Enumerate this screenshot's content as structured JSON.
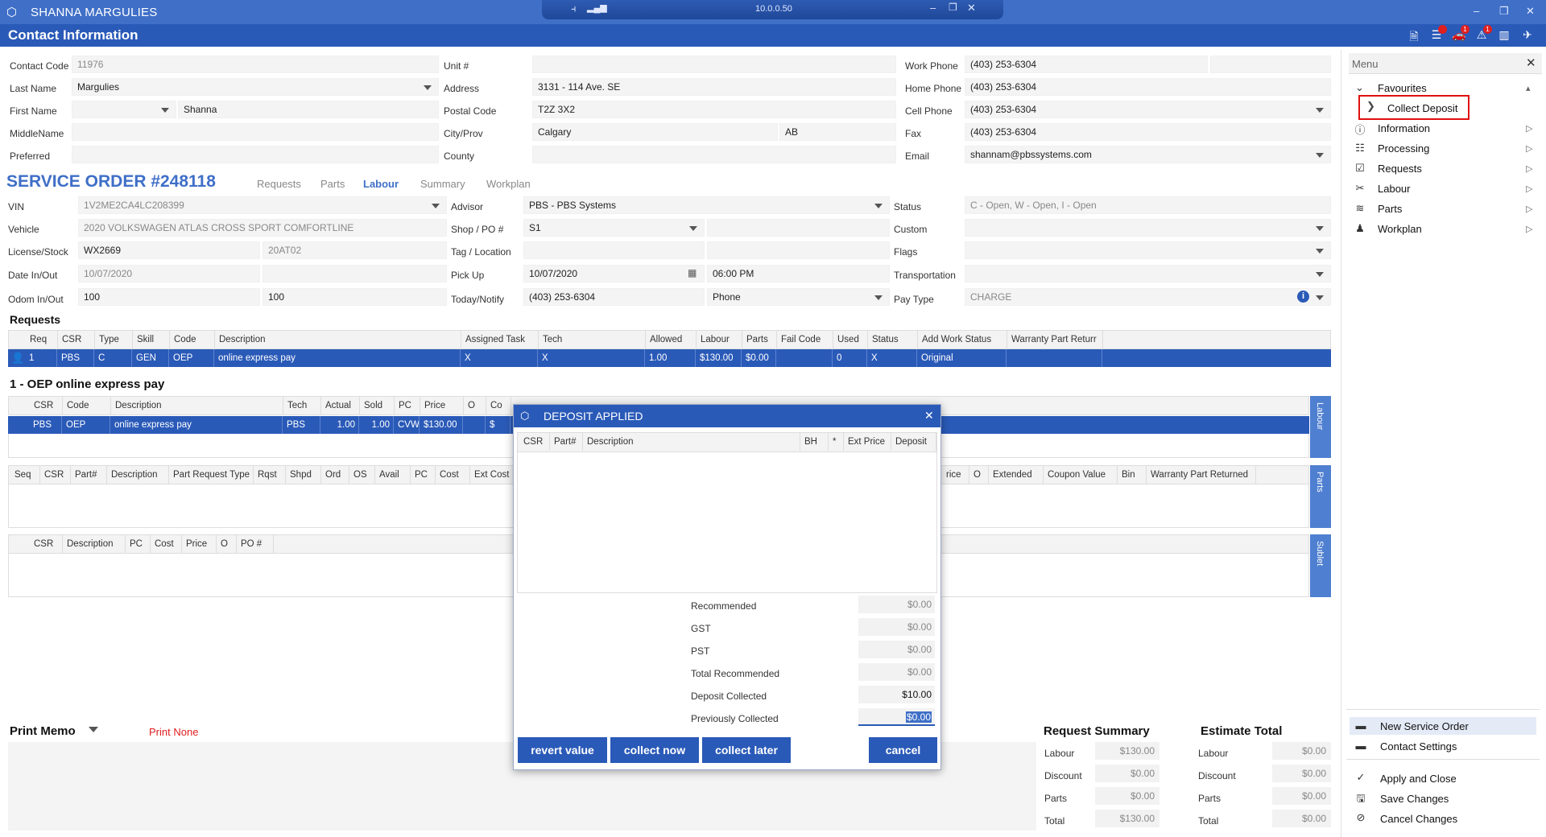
{
  "window": {
    "title": "SHANNA MARGULIES",
    "ip": "10.0.0.50"
  },
  "header": {
    "title": "Contact Information"
  },
  "contact": {
    "contact_code_label": "Contact Code",
    "contact_code": "11976",
    "last_name_label": "Last Name",
    "last_name": "Margulies",
    "first_name_label": "First Name",
    "first_name": "Shanna",
    "middle_name_label": "MiddleName",
    "preferred_label": "Preferred",
    "unit_label": "Unit #",
    "address_label": "Address",
    "address": "3131 - 114 Ave. SE",
    "postal_label": "Postal Code",
    "postal": "T2Z 3X2",
    "city_label": "City/Prov",
    "city": "Calgary",
    "prov": "AB",
    "county_label": "County",
    "work_phone_label": "Work Phone",
    "work_phone": "(403) 253-6304",
    "home_phone_label": "Home Phone",
    "home_phone": "(403) 253-6304",
    "cell_phone_label": "Cell Phone",
    "cell_phone": "(403) 253-6304",
    "fax_label": "Fax",
    "fax": "(403) 253-6304",
    "email_label": "Email",
    "email": "shannam@pbssystems.com"
  },
  "service_order": {
    "title": "SERVICE ORDER #248118",
    "tabs": [
      "Requests",
      "Parts",
      "Labour",
      "Summary",
      "Workplan"
    ],
    "vin_label": "VIN",
    "vin": "1V2ME2CA4LC208399",
    "vehicle_label": "Vehicle",
    "vehicle": "2020 VOLKSWAGEN ATLAS CROSS SPORT COMFORTLINE",
    "license_label": "License/Stock",
    "license": "WX2669",
    "stock": "20AT02",
    "date_label": "Date In/Out",
    "date_in": "10/07/2020",
    "odom_label": "Odom In/Out",
    "odom_in": "100",
    "odom_out": "100",
    "advisor_label": "Advisor",
    "advisor": "PBS - PBS Systems",
    "shop_label": "Shop / PO #",
    "shop": "S1",
    "tag_label": "Tag / Location",
    "pickup_label": "Pick Up",
    "pickup_date": "10/07/2020",
    "pickup_time": "06:00 PM",
    "notify_label": "Today/Notify",
    "notify": "(403) 253-6304",
    "notify_type": "Phone",
    "status_label": "Status",
    "status": "C - Open, W - Open, I - Open",
    "custom_label": "Custom",
    "flags_label": "Flags",
    "transport_label": "Transportation",
    "paytype_label": "Pay Type",
    "paytype": "CHARGE"
  },
  "requests": {
    "title": "Requests",
    "columns": [
      "Req",
      "CSR",
      "Type",
      "Skill",
      "Code",
      "Description",
      "Assigned Task",
      "Tech",
      "Allowed",
      "Labour",
      "Parts",
      "Fail Code",
      "Used",
      "Status",
      "Add Work Status",
      "Warranty Part Returr"
    ],
    "row": [
      "1",
      "PBS",
      "C",
      "GEN",
      "OEP",
      "online express pay",
      "X",
      "X",
      "1.00",
      "$130.00",
      "$0.00",
      "",
      "0",
      "X",
      "Original",
      ""
    ]
  },
  "labour": {
    "title": "1 - OEP online express pay",
    "columns": [
      "CSR",
      "Code",
      "Description",
      "Tech",
      "Actual",
      "Sold",
      "PC",
      "Price",
      "O",
      "Co"
    ],
    "row": [
      "PBS",
      "OEP",
      "online express pay",
      "PBS",
      "1.00",
      "1.00",
      "CVW",
      "$130.00",
      "",
      "$"
    ],
    "side_tab": "Labour"
  },
  "parts": {
    "columns_left": [
      "Seq",
      "CSR",
      "Part#",
      "Description",
      "Part Request Type",
      "Rqst",
      "Shpd",
      "Ord",
      "OS",
      "Avail",
      "PC",
      "Cost",
      "Ext Cost"
    ],
    "columns_right": [
      "rice",
      "O",
      "Extended",
      "Coupon Value",
      "Bin",
      "Warranty Part Returned"
    ],
    "side_tab": "Parts"
  },
  "sublet": {
    "columns": [
      "CSR",
      "Description",
      "PC",
      "Cost",
      "Price",
      "O",
      "PO #"
    ],
    "side_tab": "Sublet"
  },
  "print_memo": {
    "label": "Print Memo",
    "value": "Print None"
  },
  "request_summary": {
    "title": "Request Summary",
    "rows": [
      {
        "label": "Labour",
        "value": "$130.00"
      },
      {
        "label": "Discount",
        "value": "$0.00"
      },
      {
        "label": "Parts",
        "value": "$0.00"
      },
      {
        "label": "Total",
        "value": "$130.00"
      }
    ]
  },
  "estimate_total": {
    "title": "Estimate Total",
    "rows": [
      {
        "label": "Labour",
        "value": "$0.00"
      },
      {
        "label": "Discount",
        "value": "$0.00"
      },
      {
        "label": "Parts",
        "value": "$0.00"
      },
      {
        "label": "Total",
        "value": "$0.00"
      }
    ]
  },
  "menu": {
    "title": "Menu",
    "favourites": "Favourites",
    "collect_deposit": "Collect Deposit",
    "items": [
      "Information",
      "Processing",
      "Requests",
      "Labour",
      "Parts",
      "Workplan"
    ],
    "actions": [
      "New Service Order",
      "Contact Settings"
    ],
    "bottom": [
      "Apply and Close",
      "Save Changes",
      "Cancel Changes"
    ]
  },
  "modal": {
    "title": "DEPOSIT APPLIED",
    "columns": [
      "CSR",
      "Part#",
      "Description",
      "BH",
      "*",
      "Ext Price",
      "Deposit"
    ],
    "totals": [
      {
        "label": "Recommended",
        "value": "$0.00"
      },
      {
        "label": "GST",
        "value": "$0.00"
      },
      {
        "label": "PST",
        "value": "$0.00"
      },
      {
        "label": "Total Recommended",
        "value": "$0.00"
      },
      {
        "label": "Deposit Collected",
        "value": "$10.00"
      },
      {
        "label": "Previously Collected",
        "value": "$0.00"
      }
    ],
    "buttons": {
      "revert": "revert value",
      "collect_now": "collect now",
      "collect_later": "collect later",
      "cancel": "cancel"
    }
  },
  "colors": {
    "accent": "#2a5ab8",
    "highlight": "#e01010",
    "brand_blue": "#3f6fc7"
  }
}
